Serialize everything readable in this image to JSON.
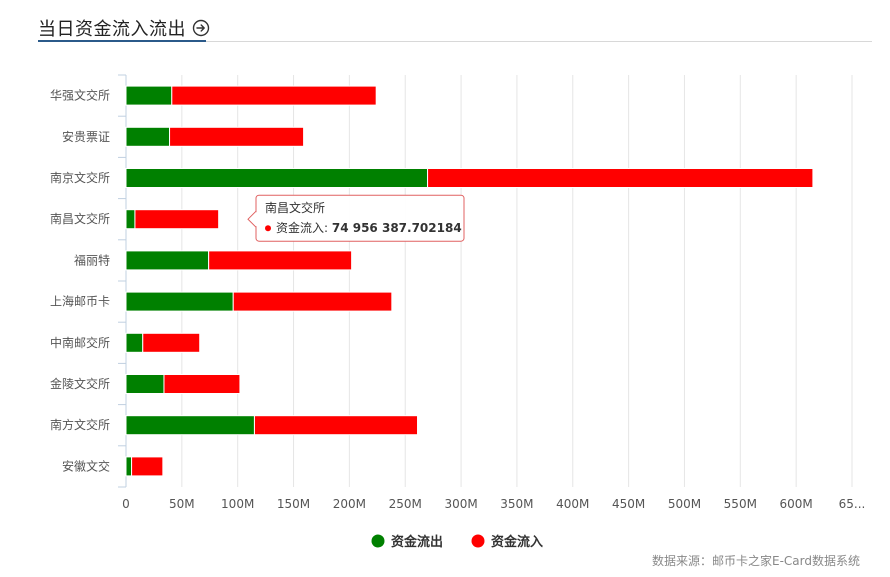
{
  "header": {
    "title": "当日资金流入流出"
  },
  "source": "数据来源：邮币卡之家E-Card数据系统",
  "tooltip": {
    "category": "南昌文交所",
    "series_name": "资金流入",
    "value": "74 956 387.702184",
    "series_color": "#ff0000"
  },
  "chart_data": {
    "type": "bar",
    "orientation": "horizontal",
    "stacked": true,
    "title": "当日资金流入流出",
    "categories": [
      "华强文交所",
      "安贵票证",
      "南京文交所",
      "南昌文交所",
      "福丽特",
      "上海邮币卡",
      "中南邮交所",
      "金陵文交所",
      "南方文交所",
      "安徽文交"
    ],
    "series": [
      {
        "name": "资金流出",
        "color": "#008000",
        "values": [
          41000000,
          39000000,
          270000000,
          8000000,
          74000000,
          96000000,
          15000000,
          34000000,
          115000000,
          5000000
        ]
      },
      {
        "name": "资金流入",
        "color": "#ff0000",
        "values": [
          183000000,
          120000000,
          345000000,
          74956387.702184,
          128000000,
          142000000,
          51000000,
          68000000,
          146000000,
          28000000
        ]
      }
    ],
    "x_ticks": [
      "0",
      "50M",
      "100M",
      "150M",
      "200M",
      "250M",
      "300M",
      "350M",
      "400M",
      "450M",
      "500M",
      "550M",
      "600M",
      "65..."
    ],
    "xlim": [
      0,
      650000000
    ],
    "grid": true,
    "legend_position": "bottom"
  }
}
